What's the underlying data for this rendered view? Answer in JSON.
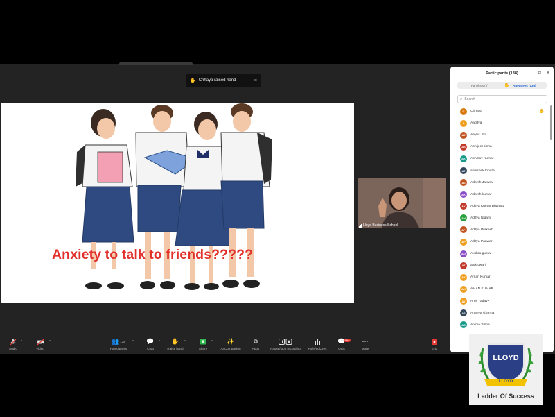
{
  "notification": {
    "text": "Chhaya raised hand",
    "close": "×"
  },
  "slide": {
    "text": "Anxiety to talk to friends?????"
  },
  "video": {
    "name": "Lloyd Business School"
  },
  "toolbar": {
    "audio": "Audio",
    "video": "Video",
    "participants": "Participants",
    "participants_count": "138",
    "chat": "Chat",
    "raise_hand": "Raise hand",
    "share": "Share",
    "ai_companion": "AI Companion",
    "apps": "Apps",
    "recording": "Pause/stop recording",
    "polls": "Polls/quizzes",
    "qa": "Q&A",
    "qa_badge": "99+",
    "more": "More",
    "end": "End"
  },
  "panel": {
    "title": "Participants (138)",
    "tabs": [
      "Panelists (2)",
      "Attendees (136)"
    ],
    "search_placeholder": "Search",
    "participants": [
      {
        "initials": "C",
        "name": "Chhaya",
        "color": "#d97a10",
        "hand": true
      },
      {
        "initials": "A",
        "name": "Aaditya",
        "color": "#f0a020"
      },
      {
        "initials": "AJ",
        "name": "Aayus Jha",
        "color": "#c0531e"
      },
      {
        "initials": "AS",
        "name": "Abhijeet sinha",
        "color": "#c23a2a"
      },
      {
        "initials": "AK",
        "name": "Abhinav Kumar",
        "color": "#1a9a8a"
      },
      {
        "initials": "AT",
        "name": "abhishek tripathi",
        "color": "#33475a"
      },
      {
        "initials": "AJ",
        "name": "Adarsh Jaiswal",
        "color": "#c0531e"
      },
      {
        "initials": "AK",
        "name": "Adarsh kumar",
        "color": "#8a4fc8"
      },
      {
        "initials": "AK",
        "name": "Aditya Kumar Bhargav",
        "color": "#c23a2a"
      },
      {
        "initials": "AN",
        "name": "Aditya Nigam",
        "color": "#2aa040"
      },
      {
        "initials": "AP",
        "name": "Aditya Prakash",
        "color": "#c0531e"
      },
      {
        "initials": "AP",
        "name": "Aditya Panwar",
        "color": "#f0a020"
      },
      {
        "initials": "AG",
        "name": "Akshra gupta",
        "color": "#8a4fc8"
      },
      {
        "initials": "AT",
        "name": "alok tiwari",
        "color": "#c23a2a"
      },
      {
        "initials": "AK",
        "name": "Aman Kumar",
        "color": "#f0a020"
      },
      {
        "initials": "AK",
        "name": "AMAN KUMAR",
        "color": "#f0a020"
      },
      {
        "initials": "AY",
        "name": "Amit Yadav~",
        "color": "#f0a020"
      },
      {
        "initials": "AS",
        "name": "Ananya sharma",
        "color": "#33475a"
      },
      {
        "initials": "AS",
        "name": "Anima Sinha",
        "color": "#1a9a8a"
      }
    ]
  },
  "logo": {
    "mark": "LLOYD",
    "ribbon": "LLOYD",
    "tagline": "Ladder Of Success"
  }
}
